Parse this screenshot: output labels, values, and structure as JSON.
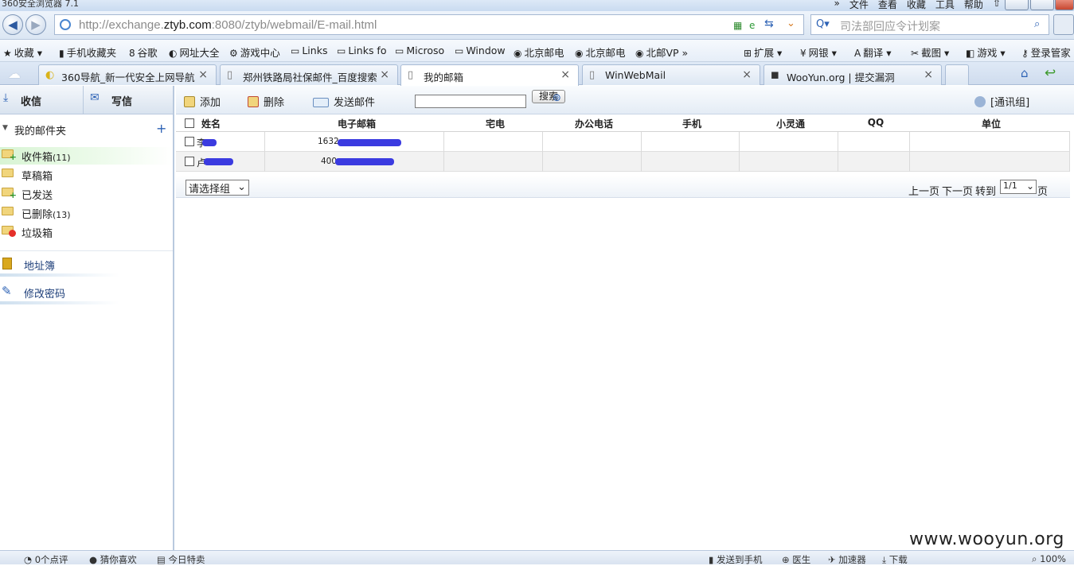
{
  "window": {
    "title": "360安全浏览器 7.1",
    "menus": [
      "文件",
      "查看",
      "收藏",
      "工具",
      "帮助"
    ]
  },
  "address": {
    "url_prefix": "http://exchange.",
    "url_domain": "ztyb.com",
    "url_suffix": ":8080/ztyb/webmail/E-mail.html",
    "search_placeholder": "司法部回应令计划案"
  },
  "favorites": [
    "收藏",
    "手机收藏夹",
    "谷歌",
    "网址大全",
    "游戏中心",
    "Links",
    "Links fo",
    "Microso",
    "Window",
    "北京邮电",
    "北京邮电",
    "北邮VP",
    "扩展",
    "网银",
    "翻译",
    "截图",
    "游戏",
    "登录管家"
  ],
  "tabs": [
    {
      "label": "360导航_新一代安全上网导航"
    },
    {
      "label": "郑州铁路局社保邮件_百度搜索"
    },
    {
      "label": "我的邮箱"
    },
    {
      "label": "WinWebMail"
    },
    {
      "label": "WooYun.org | 提交漏洞"
    }
  ],
  "sidebar": {
    "receive": "收信",
    "compose": "写信",
    "folders_title": "我的邮件夹",
    "folders": [
      {
        "label": "收件箱",
        "count": "(11)"
      },
      {
        "label": "草稿箱",
        "count": ""
      },
      {
        "label": "已发送",
        "count": ""
      },
      {
        "label": "已删除",
        "count": "(13)"
      },
      {
        "label": "垃圾箱",
        "count": ""
      }
    ],
    "address_book": "地址簿",
    "change_password": "修改密码"
  },
  "toolbar": {
    "add": "添加",
    "delete": "删除",
    "send_mail": "发送邮件",
    "search": "搜索",
    "contacts_group": "[通讯组]"
  },
  "table": {
    "headers": [
      "姓名",
      "电子邮箱",
      "宅电",
      "办公电话",
      "手机",
      "小灵通",
      "QQ",
      "单位"
    ],
    "rows": [
      {
        "name": "李",
        "email": "1632"
      },
      {
        "name": "卢",
        "email": "400"
      }
    ]
  },
  "footer": {
    "group_select": "请选择组",
    "prev": "上一页",
    "next": "下一页",
    "goto": "转到",
    "page_value": "1/1",
    "page_unit": "页"
  },
  "status": {
    "items": [
      "0个点评",
      "猜你喜欢",
      "今日特卖",
      "发送到手机",
      "医生",
      "加速器",
      "下载",
      "100%"
    ]
  },
  "watermark": "www.wooyun.org"
}
